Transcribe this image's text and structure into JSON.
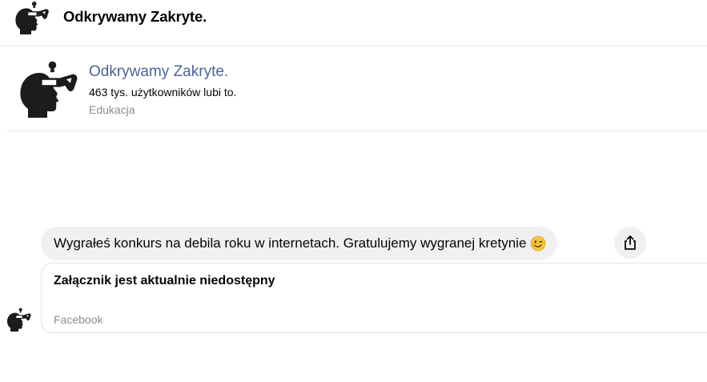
{
  "header": {
    "title": "Odkrywamy Zakryte."
  },
  "page_card": {
    "name": "Odkrywamy Zakryte.",
    "likes": "463 tys. użytkowników lubi to.",
    "category": "Edukacja"
  },
  "message": {
    "text": "Wygrałeś konkurs na debila roku w internetach. Gratulujemy wygranej kretynie",
    "emoji": "winking-face"
  },
  "attachment": {
    "title": "Załącznik jest aktualnie niedostępny",
    "source": "Facebook"
  },
  "colors": {
    "accent_name": "#4b6496",
    "bubble_bg": "#f0f0f0",
    "muted_text": "#8a8d91"
  }
}
